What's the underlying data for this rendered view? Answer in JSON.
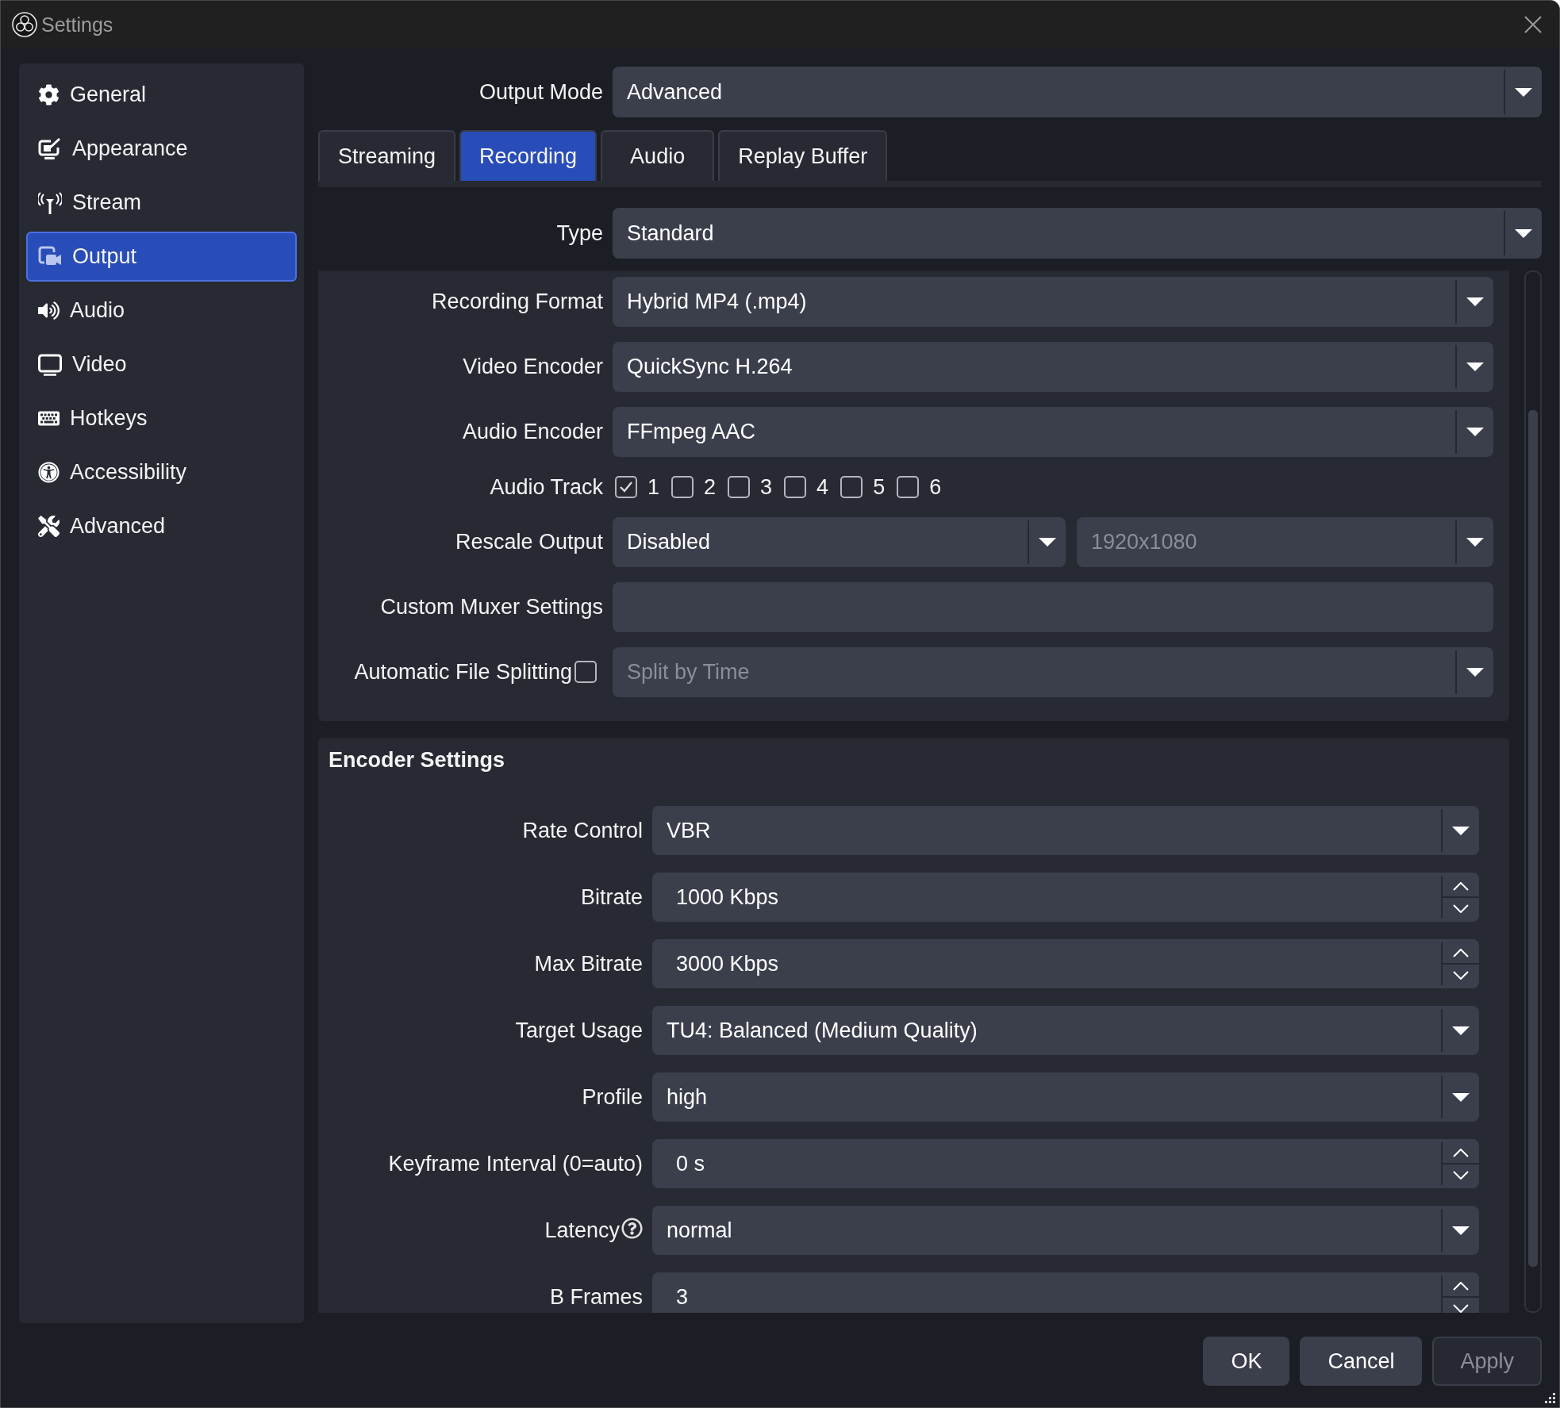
{
  "window": {
    "title": "Settings"
  },
  "sidebar": {
    "items": [
      {
        "label": "General",
        "selected": false
      },
      {
        "label": "Appearance",
        "selected": false
      },
      {
        "label": "Stream",
        "selected": false
      },
      {
        "label": "Output",
        "selected": true
      },
      {
        "label": "Audio",
        "selected": false
      },
      {
        "label": "Video",
        "selected": false
      },
      {
        "label": "Hotkeys",
        "selected": false
      },
      {
        "label": "Accessibility",
        "selected": false
      },
      {
        "label": "Advanced",
        "selected": false
      }
    ]
  },
  "output_mode": {
    "label": "Output Mode",
    "value": "Advanced"
  },
  "tabs": [
    {
      "label": "Streaming",
      "selected": false
    },
    {
      "label": "Recording",
      "selected": true
    },
    {
      "label": "Audio",
      "selected": false
    },
    {
      "label": "Replay Buffer",
      "selected": false
    }
  ],
  "type": {
    "label": "Type",
    "value": "Standard"
  },
  "recording": {
    "rows": [
      {
        "kind": "dropdown",
        "label": "Recording Format",
        "value": "Hybrid MP4 (.mp4)",
        "disabled": false
      },
      {
        "kind": "dropdown",
        "label": "Video Encoder",
        "value": "QuickSync H.264",
        "disabled": false
      },
      {
        "kind": "dropdown",
        "label": "Audio Encoder",
        "value": "FFmpeg AAC",
        "disabled": false
      },
      {
        "kind": "checkboxes",
        "label": "Audio Track",
        "options": [
          {
            "label": "1",
            "checked": true
          },
          {
            "label": "2",
            "checked": false
          },
          {
            "label": "3",
            "checked": false
          },
          {
            "label": "4",
            "checked": false
          },
          {
            "label": "5",
            "checked": false
          },
          {
            "label": "6",
            "checked": false
          }
        ]
      },
      {
        "kind": "dropdown_pair",
        "label": "Rescale Output",
        "fields": [
          {
            "value": "Disabled",
            "disabled": false
          },
          {
            "value": "1920x1080",
            "disabled": true
          }
        ]
      },
      {
        "kind": "text",
        "label": "Custom Muxer Settings"
      },
      {
        "kind": "checked_dropdown",
        "label": "Automatic File Splitting",
        "checked": false,
        "value": "Split by Time",
        "disabled": true
      }
    ]
  },
  "encoder_settings": {
    "title": "Encoder Settings",
    "rows": [
      {
        "kind": "dropdown",
        "label": "Rate Control",
        "value": "VBR",
        "help": false
      },
      {
        "kind": "spin",
        "label": "Bitrate",
        "value": "1000 Kbps",
        "help": false
      },
      {
        "kind": "spin",
        "label": "Max Bitrate",
        "value": "3000 Kbps",
        "help": false
      },
      {
        "kind": "dropdown",
        "label": "Target Usage",
        "value": "TU4: Balanced (Medium Quality)",
        "help": false
      },
      {
        "kind": "dropdown",
        "label": "Profile",
        "value": "high",
        "help": false
      },
      {
        "kind": "spin",
        "label": "Keyframe Interval (0=auto)",
        "value": "0 s",
        "help": false
      },
      {
        "kind": "dropdown",
        "label": "Latency",
        "value": "normal",
        "help": true
      },
      {
        "kind": "spin",
        "label": "B Frames",
        "value": "3",
        "help": false
      }
    ]
  },
  "buttons": [
    {
      "label": "OK",
      "disabled": false
    },
    {
      "label": "Cancel",
      "disabled": false
    },
    {
      "label": "Apply",
      "disabled": true
    }
  ]
}
